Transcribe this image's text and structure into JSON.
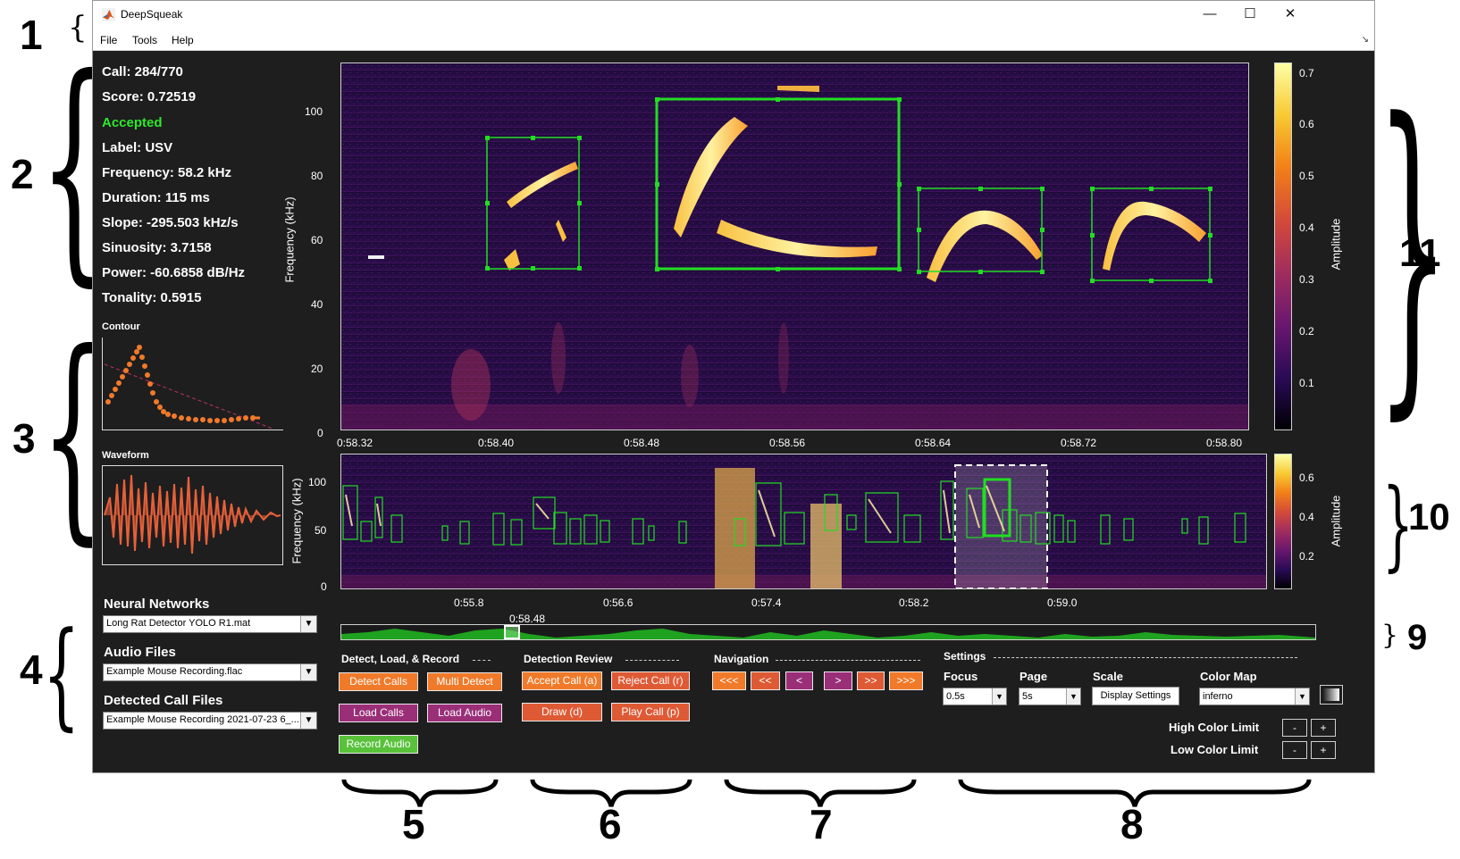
{
  "annotations": [
    "1",
    "2",
    "3",
    "4",
    "5",
    "6",
    "7",
    "8",
    "9",
    "10",
    "11"
  ],
  "window": {
    "title": "DeepSqueak",
    "controls": {
      "minimize": "—",
      "maximize": "☐",
      "close": "✕"
    },
    "corner_glyph": "↘",
    "menu": [
      "File",
      "Tools",
      "Help"
    ]
  },
  "call_info": {
    "call": "Call: 284/770",
    "score": "Score: 0.72519",
    "status": "Accepted",
    "label": "Label: USV",
    "frequency": "Frequency: 58.2 kHz",
    "duration": "Duration: 115 ms",
    "slope": "Slope: -295.503 kHz/s",
    "sinuosity": "Sinuosity: 3.7158",
    "power": "Power: -60.6858 dB/Hz",
    "tonality": "Tonality: 0.5915"
  },
  "contour_label": "Contour",
  "waveform_label": "Waveform",
  "file_panel": {
    "neural_networks_label": "Neural Networks",
    "neural_network_value": "Long Rat Detector YOLO R1.mat",
    "audio_files_label": "Audio Files",
    "audio_file_value": "Example Mouse Recording.flac",
    "detected_calls_label": "Detected Call Files",
    "detected_calls_value": "Example Mouse Recording 2021-07-23  6_..."
  },
  "main_spectrogram": {
    "ylabel": "Frequency (kHz)",
    "yticks": [
      "100",
      "80",
      "60",
      "40",
      "20",
      "0"
    ],
    "xticks": [
      "0:58.32",
      "0:58.40",
      "0:58.48",
      "0:58.56",
      "0:58.64",
      "0:58.72",
      "0:58.80"
    ],
    "colorbar_label": "Amplitude",
    "colorbar_ticks": [
      "0.7",
      "0.6",
      "0.5",
      "0.4",
      "0.3",
      "0.2",
      "0.1"
    ]
  },
  "overview_spectrogram": {
    "ylabel": "Frequency (kHz)",
    "yticks": [
      "100",
      "50",
      "0"
    ],
    "xticks": [
      "0:55.8",
      "0:56.6",
      "0:57.4",
      "0:58.2",
      "0:59.0"
    ],
    "colorbar_label": "Amplitude",
    "colorbar_ticks": [
      "0.6",
      "0.4",
      "0.2"
    ]
  },
  "timeline": {
    "position_label": "0:58.48",
    "position_fraction": 0.17
  },
  "detect_group": {
    "title": "Detect, Load, & Record",
    "detect_calls": "Detect Calls",
    "multi_detect": "Multi Detect",
    "load_calls": "Load Calls",
    "load_audio": "Load Audio",
    "record_audio": "Record Audio"
  },
  "review_group": {
    "title": "Detection Review",
    "accept": "Accept Call (a)",
    "reject": "Reject Call (r)",
    "draw": "Draw (d)",
    "play": "Play Call (p)"
  },
  "nav_group": {
    "title": "Navigation",
    "buttons": [
      "<<<",
      "<<",
      "<",
      ">",
      ">>",
      ">>>"
    ]
  },
  "settings_group": {
    "title": "Settings",
    "focus_label": "Focus",
    "focus_value": "0.5s",
    "page_label": "Page",
    "page_value": "5s",
    "scale_label": "Scale",
    "display_settings": "Display Settings",
    "colormap_label": "Color Map",
    "colormap_value": "inferno",
    "high_color": "High Color Limit",
    "low_color": "Low Color Limit",
    "minus": "-",
    "plus": "+"
  },
  "colors": {
    "accepted": "#2ee82e",
    "box": "#22dd22",
    "orange_button": "#f07a2a",
    "purple_button": "#9a2f78",
    "green_button": "#58c23a",
    "contour": "#f07a2a",
    "waveform": "#e8603a"
  }
}
